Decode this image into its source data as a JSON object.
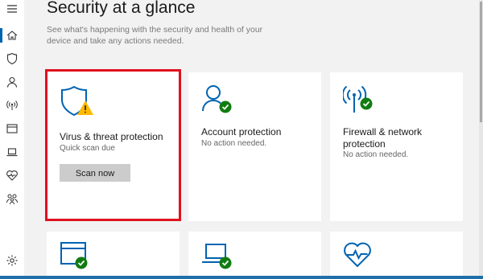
{
  "page": {
    "title": "Security at a glance",
    "subtitle": "See what's happening with the security and health of your device and take any actions needed."
  },
  "colors": {
    "accent": "#0063b1",
    "ok": "#107c10",
    "warning": "#ffb900",
    "highlight": "#e0111e"
  },
  "nav": {
    "items": [
      {
        "icon": "hamburger-icon"
      },
      {
        "icon": "home-icon",
        "selected": true
      },
      {
        "icon": "shield-icon"
      },
      {
        "icon": "person-icon"
      },
      {
        "icon": "wifi-antenna-icon"
      },
      {
        "icon": "browser-window-icon"
      },
      {
        "icon": "laptop-icon"
      },
      {
        "icon": "heart-pulse-icon"
      },
      {
        "icon": "family-icon"
      },
      {
        "icon": "gear-icon"
      }
    ]
  },
  "tiles": {
    "virus": {
      "title": "Virus & threat protection",
      "status": "Quick scan due",
      "button": "Scan now",
      "icon": "shield-warning-icon"
    },
    "account": {
      "title": "Account protection",
      "status": "No action needed.",
      "icon": "account-check-icon"
    },
    "firewall": {
      "title": "Firewall & network protection",
      "status": "No action needed.",
      "icon": "antenna-check-icon"
    },
    "app_browser": {
      "icon": "browser-check-icon"
    },
    "device_security": {
      "icon": "laptop-check-icon"
    },
    "health": {
      "icon": "heart-pulse-icon"
    }
  }
}
